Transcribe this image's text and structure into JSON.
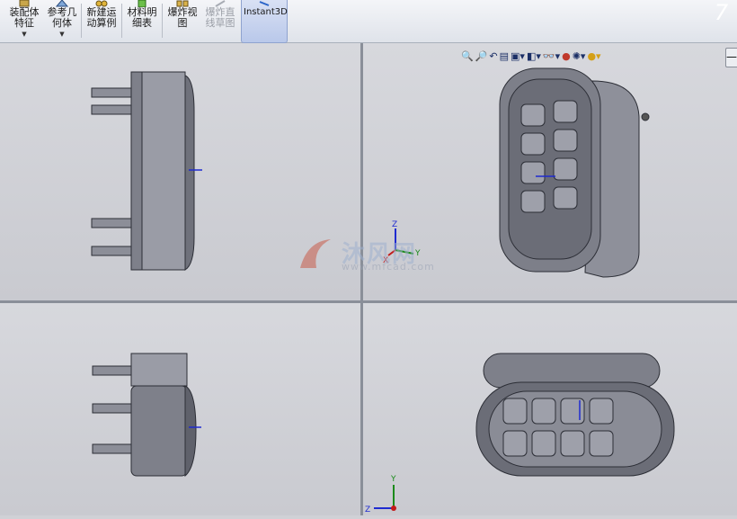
{
  "ribbon": {
    "buttons": [
      {
        "id": "assembly-feature",
        "label": "装配体\n特征",
        "has_dropdown": true,
        "disabled": false
      },
      {
        "id": "reference-geometry",
        "label": "参考几\n何体",
        "has_dropdown": true,
        "disabled": false
      },
      {
        "id": "new-motion-study",
        "label": "新建运\n动算例",
        "has_dropdown": false,
        "disabled": false
      },
      {
        "id": "bill-of-materials",
        "label": "材料明\n细表",
        "has_dropdown": false,
        "disabled": false
      },
      {
        "id": "exploded-view",
        "label": "爆炸视\n图",
        "has_dropdown": false,
        "disabled": false
      },
      {
        "id": "explode-line-sketch",
        "label": "爆炸直\n线草图",
        "has_dropdown": false,
        "disabled": true
      },
      {
        "id": "instant3d",
        "label": "Instant3D",
        "has_dropdown": false,
        "disabled": false,
        "active": true
      }
    ]
  },
  "view_toolbar": {
    "icons": [
      "zoom-to-fit-icon",
      "zoom-to-area-icon",
      "previous-view-icon",
      "section-view-icon",
      "view-orientation-icon",
      "display-style-icon",
      "hide-show-items-icon",
      "edit-appearance-icon",
      "apply-scene-icon",
      "view-settings-icon"
    ]
  },
  "triad": {
    "top_right": {
      "z": "Z",
      "y": "Y",
      "x": "X"
    },
    "bottom_right": {
      "y": "Y",
      "z": "Z"
    }
  },
  "watermark": {
    "brand": "沐风网",
    "url": "www.mfcad.com"
  },
  "collapse_label": "—"
}
